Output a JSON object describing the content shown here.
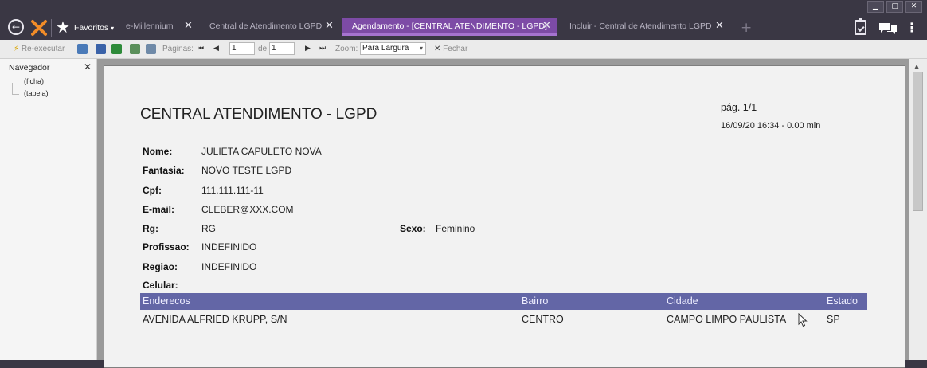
{
  "window": {
    "controls": [
      "▁",
      "▢",
      "✕"
    ]
  },
  "header": {
    "favorites_label": "Favoritos",
    "tabs": [
      {
        "label": "e-Millennium"
      },
      {
        "label": "Central de Atendimento LGPD"
      },
      {
        "label": "Agendamento - [CENTRAL ATENDIMENTO - LGPD]"
      },
      {
        "label": "Incluir - Central de Atendimento LGPD"
      }
    ]
  },
  "toolbar": {
    "reexecute_label": "Re-executar",
    "pages_label": "Páginas:",
    "page_current": "1",
    "of_label": "de",
    "page_total": "1",
    "zoom_label": "Zoom:",
    "zoom_value": "Para Largura",
    "close_label": "Fechar"
  },
  "navigator": {
    "title": "Navegador",
    "items": [
      "(ficha)",
      "(tabela)"
    ]
  },
  "report": {
    "title": "CENTRAL ATENDIMENTO - LGPD",
    "page_label": "pág. 1/1",
    "datetime": "16/09/20 16:34 - 0.00 min",
    "fields": [
      {
        "label": "Nome:",
        "value": "JULIETA CAPULETO NOVA"
      },
      {
        "label": "Fantasia:",
        "value": "NOVO TESTE LGPD"
      },
      {
        "label": "Cpf:",
        "value": "111.111.111-11"
      },
      {
        "label": "E-mail:",
        "value": "CLEBER@XXX.COM"
      },
      {
        "label": "Rg:",
        "value": "RG"
      },
      {
        "label": "Profissao:",
        "value": "INDEFINIDO"
      },
      {
        "label": "Regiao:",
        "value": "INDEFINIDO"
      },
      {
        "label": "Celular:",
        "value": ""
      }
    ],
    "sexo": {
      "label": "Sexo:",
      "value": "Feminino"
    },
    "table": {
      "columns": [
        "Enderecos",
        "Bairro",
        "Cidade",
        "Estado"
      ],
      "rows": [
        [
          "AVENIDA ALFRIED KRUPP, S/N",
          "CENTRO",
          "CAMPO LIMPO PAULISTA",
          "SP"
        ]
      ]
    }
  },
  "colors": {
    "accent": "#7d4ba6",
    "table_header": "#6366a6",
    "topbar": "#3a3744"
  }
}
